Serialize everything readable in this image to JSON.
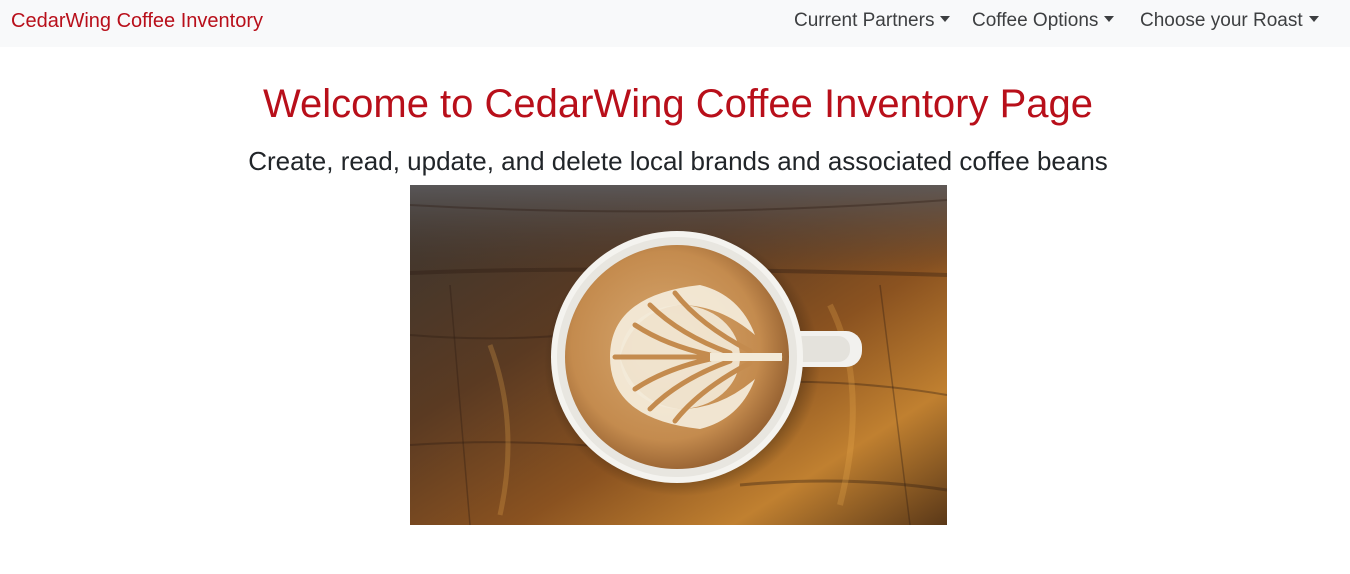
{
  "navbar": {
    "brand": "CedarWing Coffee Inventory",
    "items": [
      {
        "label": "Current Partners"
      },
      {
        "label": "Coffee Options"
      },
      {
        "label": "Choose your Roast"
      }
    ]
  },
  "main": {
    "title": "Welcome to CedarWing Coffee Inventory Page",
    "subtitle": "Create, read, update, and delete local brands and associated coffee beans"
  },
  "colors": {
    "brand": "#b80f1a",
    "navbar_bg": "#f8f9fa",
    "text": "#212529"
  },
  "icons": {
    "dropdown": "caret-down-icon"
  }
}
